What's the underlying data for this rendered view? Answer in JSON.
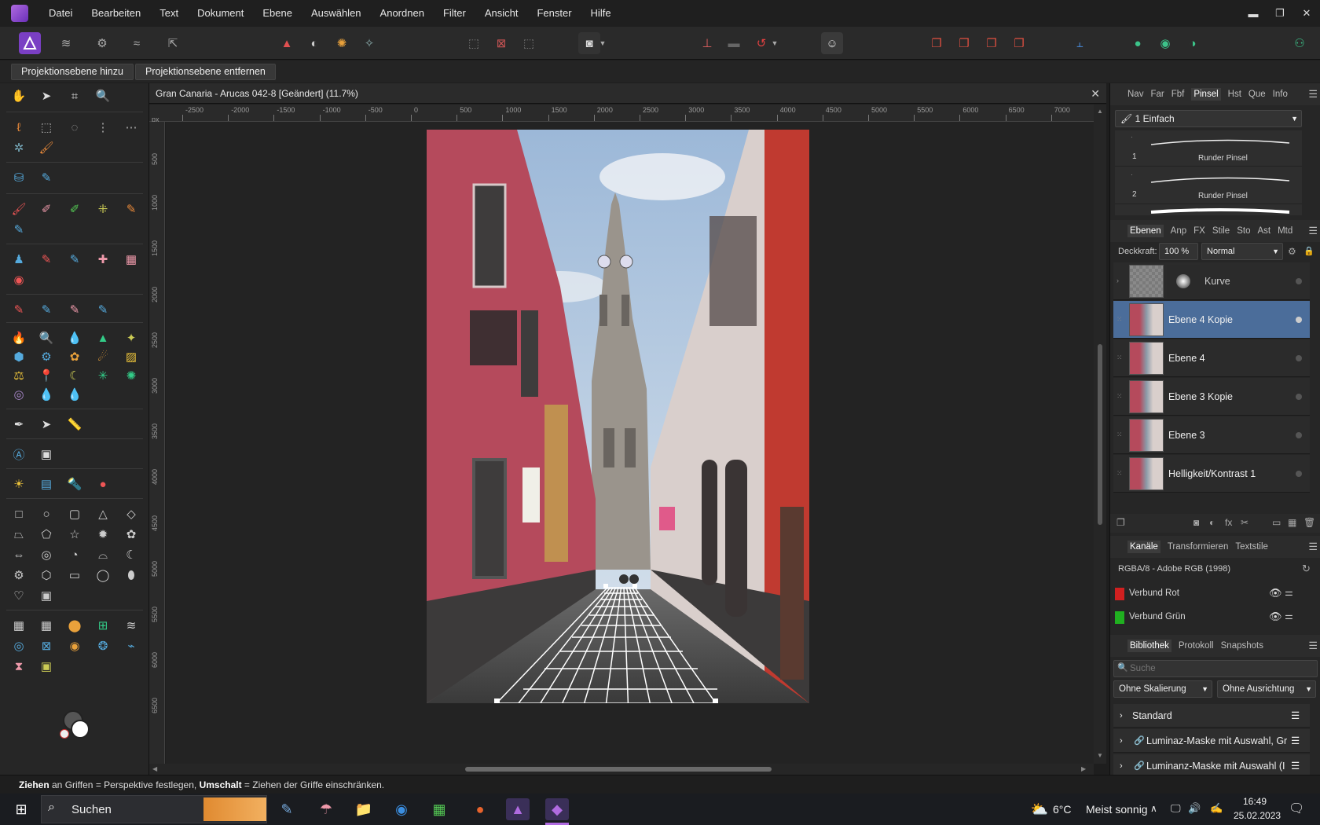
{
  "menu": [
    "Datei",
    "Bearbeiten",
    "Text",
    "Dokument",
    "Ebene",
    "Auswählen",
    "Anordnen",
    "Filter",
    "Ansicht",
    "Fenster",
    "Hilfe"
  ],
  "window_controls": {
    "minimize": "▬",
    "restore": "❐",
    "close": "✕"
  },
  "context": {
    "add_label": "Projektionsebene hinzu",
    "remove_label": "Projektionsebene entfernen"
  },
  "document": {
    "title": "Gran Canaria - Arucas 042-8 [Geändert] (11.7%)",
    "ruler_unit": "px",
    "ruler_h": [
      "-2500",
      "-2000",
      "-1500",
      "-1000",
      "-500",
      "0",
      "500",
      "1000",
      "1500",
      "2000",
      "2500",
      "3000",
      "3500",
      "4000",
      "4500",
      "5000",
      "5500",
      "6000",
      "6500",
      "7000"
    ],
    "ruler_v": [
      "500",
      "1000",
      "1500",
      "2000",
      "2500",
      "3000",
      "3500",
      "4000",
      "4500",
      "5000",
      "5500",
      "6000",
      "6500"
    ]
  },
  "brushes": {
    "tabs": [
      "Nav",
      "Far",
      "Fbf",
      "Pinsel",
      "Hst",
      "Que",
      "Info"
    ],
    "active_tab": "Pinsel",
    "category": "1 Einfach",
    "items": [
      {
        "index": "1",
        "name": "Runder Pinsel"
      },
      {
        "index": "2",
        "name": "Runder Pinsel"
      }
    ]
  },
  "layers": {
    "tabs": [
      "Ebenen",
      "Anp",
      "FX",
      "Stile",
      "Sto",
      "Ast",
      "Mtd"
    ],
    "opacity_label": "Deckkraft:",
    "opacity_value": "100 %",
    "blend_mode": "Normal",
    "items": [
      {
        "name": "Kurve",
        "selected": false
      },
      {
        "name": "Ebene 4 Kopie",
        "selected": true
      },
      {
        "name": "Ebene 4",
        "selected": false
      },
      {
        "name": "Ebene 3 Kopie",
        "selected": false
      },
      {
        "name": "Ebene 3",
        "selected": false
      },
      {
        "name": "Helligkeit/Kontrast 1",
        "selected": false
      }
    ]
  },
  "channels": {
    "tabs": [
      "Kanäle",
      "Transformieren",
      "Textstile"
    ],
    "profile": "RGBA/8 - Adobe RGB (1998)",
    "items": [
      "Verbund Rot",
      "Verbund Grün"
    ]
  },
  "library": {
    "tabs": [
      "Bibliothek",
      "Protokoll",
      "Snapshots"
    ],
    "search_placeholder": "Suche",
    "scale": "Ohne Skalierung",
    "align": "Ohne Ausrichtung",
    "rows": [
      "Standard",
      "Luminaz-Maske mit Auswahl, Gr",
      "Luminanz-Maske mit Auswahl (I"
    ]
  },
  "status": {
    "b1": "Ziehen",
    "t1": " an Griffen = Perspektive festlegen, ",
    "b2": "Umschalt",
    "t2": " = Ziehen der Griffe einschränken."
  },
  "taskbar": {
    "search": "Suchen",
    "weather_temp": "6°C",
    "weather_text": "Meist sonnig",
    "time": "16:49",
    "date": "25.02.2023"
  },
  "colors": {
    "accent": "#4b6d9a",
    "menu_bg": "#1f1f1f",
    "panel_bg": "#262626"
  }
}
